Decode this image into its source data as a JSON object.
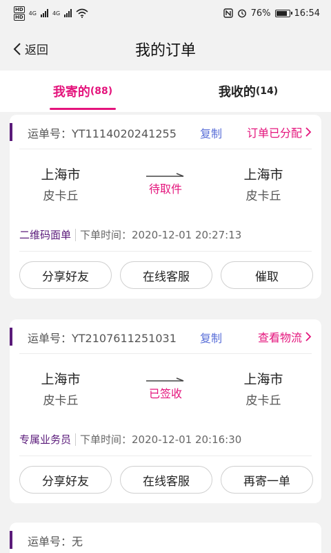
{
  "status_bar": {
    "hd1": "HD",
    "hd2": "HD",
    "net1": "4G",
    "net2": "4G",
    "battery_text": "76%",
    "battery_level": 0.76,
    "time": "16:54"
  },
  "nav": {
    "back_label": "返回",
    "title": "我的订单"
  },
  "tabs": [
    {
      "label": "我寄的",
      "count": "(88)",
      "active": true
    },
    {
      "label": "我收的",
      "count": "(14)",
      "active": false
    }
  ],
  "orders": [
    {
      "waybill": "运单号：YT1114020241255",
      "copy_label": "复制",
      "status_link": "订单已分配",
      "from_city": "上海市",
      "from_district": "皮卡丘",
      "route_status": "待取件",
      "to_city": "上海市",
      "to_district": "皮卡丘",
      "tag": "二维码面单",
      "time": "下单时间：2020-12-01 20:27:13",
      "buttons": [
        "分享好友",
        "在线客服",
        "催取"
      ]
    },
    {
      "waybill": "运单号：YT2107611251031",
      "copy_label": "复制",
      "status_link": "查看物流",
      "from_city": "上海市",
      "from_district": "皮卡丘",
      "route_status": "已签收",
      "to_city": "上海市",
      "to_district": "皮卡丘",
      "tag": "专属业务员",
      "time": "下单时间：2020-12-01 20:16:30",
      "buttons": [
        "分享好友",
        "在线客服",
        "再寄一单"
      ]
    },
    {
      "waybill": "运单号：无"
    }
  ],
  "colors": {
    "accent": "#e4147c",
    "purple": "#5a1a7a",
    "link": "#5a6fd8"
  }
}
